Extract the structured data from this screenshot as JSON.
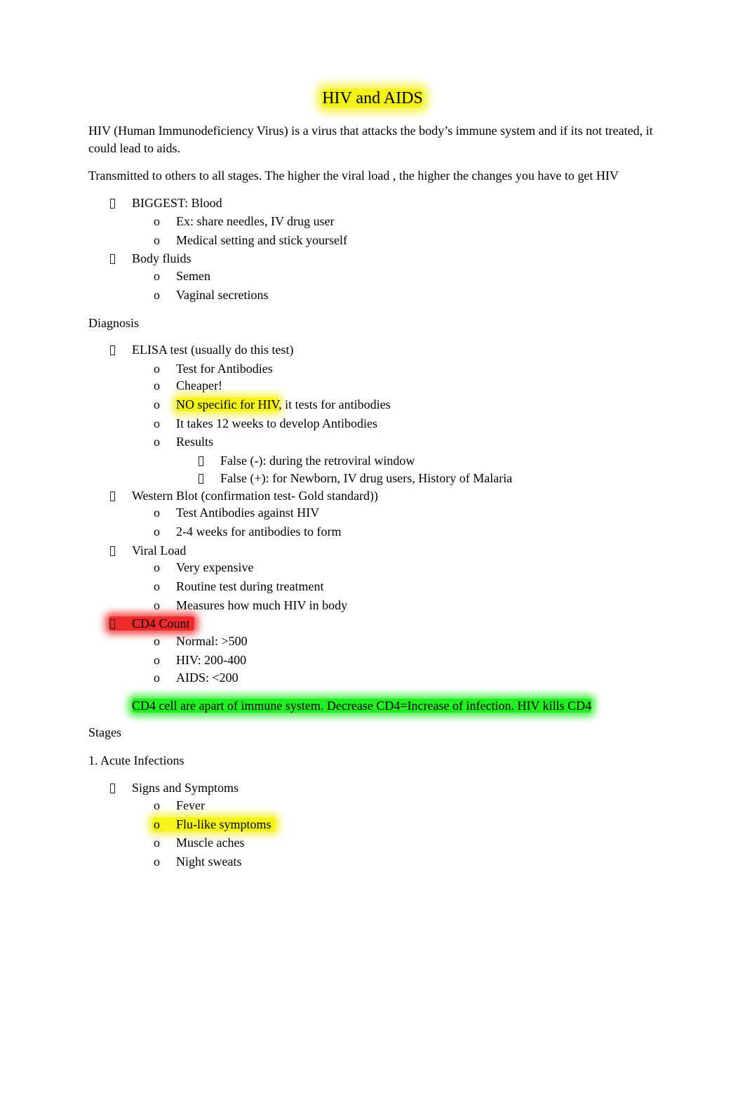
{
  "document": {
    "title": "HIV and AIDS",
    "intro": "HIV (Human Immunodeficiency Virus) is a virus that attacks the body’s immune system and if its not treated, it could lead to aids.",
    "transmission": "Transmitted to others to all stages. The higher the viral load , the higher the changes you have to get HIV",
    "transmission_list": [
      {
        "label": "BIGGEST: Blood",
        "children": [
          "Ex: share needles, IV drug user",
          "Medical setting and stick yourself"
        ]
      },
      {
        "label": "Body fluids",
        "children": [
          "Semen",
          "Vaginal secretions"
        ]
      }
    ],
    "diagnosis_heading": "Diagnosis",
    "diagnosis_list": [
      {
        "label": "ELISA test (usually do this test)",
        "children": [
          {
            "text": "Test for Antibodies"
          },
          {
            "text": "Cheaper!"
          },
          {
            "highlight": "NO specific for HIV",
            "text": ", it tests for antibodies"
          },
          {
            "text": "It takes 12 weeks to develop Antibodies"
          },
          {
            "text": "Results",
            "children": [
              "False (-): during the retroviral window",
              "False (+): for Newborn, IV drug users, History of Malaria"
            ]
          }
        ]
      },
      {
        "label": "Western Blot (confirmation test- Gold standard))",
        "children": [
          {
            "text": "Test Antibodies against HIV"
          },
          {
            "text": "2-4 weeks for antibodies to form"
          }
        ]
      },
      {
        "label": "Viral Load",
        "children": [
          {
            "text": "Very expensive"
          },
          {
            "text": "Routine test during treatment"
          },
          {
            "text": "Measures how much HIV in body"
          }
        ]
      },
      {
        "label": "CD4 Count",
        "children": [
          {
            "text": "Normal: >500"
          },
          {
            "text": "HIV: 200-400"
          },
          {
            "text": "AIDS: <200"
          }
        ]
      }
    ],
    "cd4_note": "CD4 cell are apart of immune system. Decrease CD4=Increase of infection. HIV kills CD4",
    "stages_heading": "Stages",
    "stage_1_heading": "1. Acute Infections",
    "stage_1_list": [
      {
        "label": "Signs and Symptoms",
        "children": [
          "Fever",
          "Flu-like symptoms",
          "Muscle aches",
          "Night sweats"
        ]
      }
    ],
    "bullet_level2": "o",
    "highlight_colors": {
      "yellow": "#f2f216",
      "red": "#ee2a2a",
      "green": "#22ee22"
    }
  }
}
